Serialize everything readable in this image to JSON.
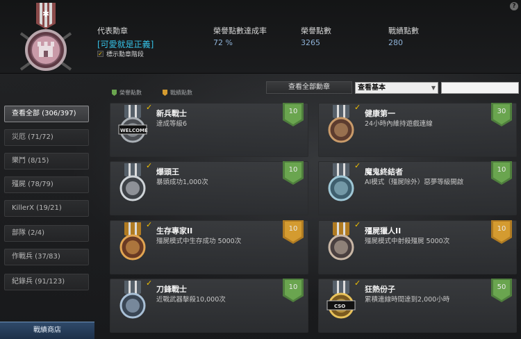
{
  "colors": {
    "honor": "#4f7f3d",
    "honor_light": "#6aa54f",
    "record": "#b07b22",
    "record_light": "#d49b30",
    "accent_blue": "#35c3e8"
  },
  "header": {
    "help": "?",
    "rep_label": "代表勳章",
    "rep_value": "[可愛就是正義]",
    "show_level_label": "標示勳章階段",
    "rate_label": "榮譽點數達成率",
    "rate_value": "72 %",
    "honor_label": "榮譽點數",
    "honor_value": "3265",
    "record_label": "戰績點數",
    "record_value": "280"
  },
  "legend": {
    "honor": "榮譽點數",
    "record": "戰績點數"
  },
  "toolbar": {
    "view_all": "查看全部勳章",
    "view_select": "查看基本",
    "search_placeholder": ""
  },
  "categories": [
    {
      "label": "查看全部 (306/397)"
    },
    {
      "label": "災厄 (71/72)"
    },
    {
      "label": "樂鬥 (8/15)"
    },
    {
      "label": "殭屍 (78/79)"
    },
    {
      "label": "KillerX (19/21)"
    },
    {
      "label": "部隊 (2/4)"
    },
    {
      "label": "作戰兵 (37/83)"
    },
    {
      "label": "紀錄兵 (91/123)"
    }
  ],
  "shop": "戰績商店",
  "medals": [
    {
      "title": "新兵戰士",
      "desc": "達成等級6",
      "points": "10",
      "type": "honor",
      "icon": "welcome-cso-medal-icon",
      "badge": "WELCOME"
    },
    {
      "title": "健康第一",
      "desc": "24小時內維持遊戲連線",
      "points": "30",
      "type": "honor",
      "icon": "health-medal-icon",
      "badge": ""
    },
    {
      "title": "爆頭王",
      "desc": "暴頭成功1,000次",
      "points": "10",
      "type": "honor",
      "icon": "skull-medal-icon",
      "badge": ""
    },
    {
      "title": "魔鬼終結者",
      "desc": "AI模式（殭屍除外）惡夢等級開啟",
      "points": "10",
      "type": "honor",
      "icon": "terminator-medal-icon",
      "badge": ""
    },
    {
      "title": "生存專家II",
      "desc": "殭屍模式中生存成功 5000次",
      "points": "10",
      "type": "record",
      "icon": "survival-medal-icon",
      "badge": ""
    },
    {
      "title": "殭屍獵人II",
      "desc": "殭屍模式中射殺殭屍 5000次",
      "points": "10",
      "type": "record",
      "icon": "zombie-hunter-medal-icon",
      "badge": ""
    },
    {
      "title": "刀鋒戰士",
      "desc": "近戰武器擊殺10,000次",
      "points": "10",
      "type": "honor",
      "icon": "blade-medal-icon",
      "badge": ""
    },
    {
      "title": "狂熱份子",
      "desc": "累積連線時間達到2,000小時",
      "points": "50",
      "type": "honor",
      "icon": "fanatic-cso-medal-icon",
      "badge": "CSO"
    }
  ]
}
